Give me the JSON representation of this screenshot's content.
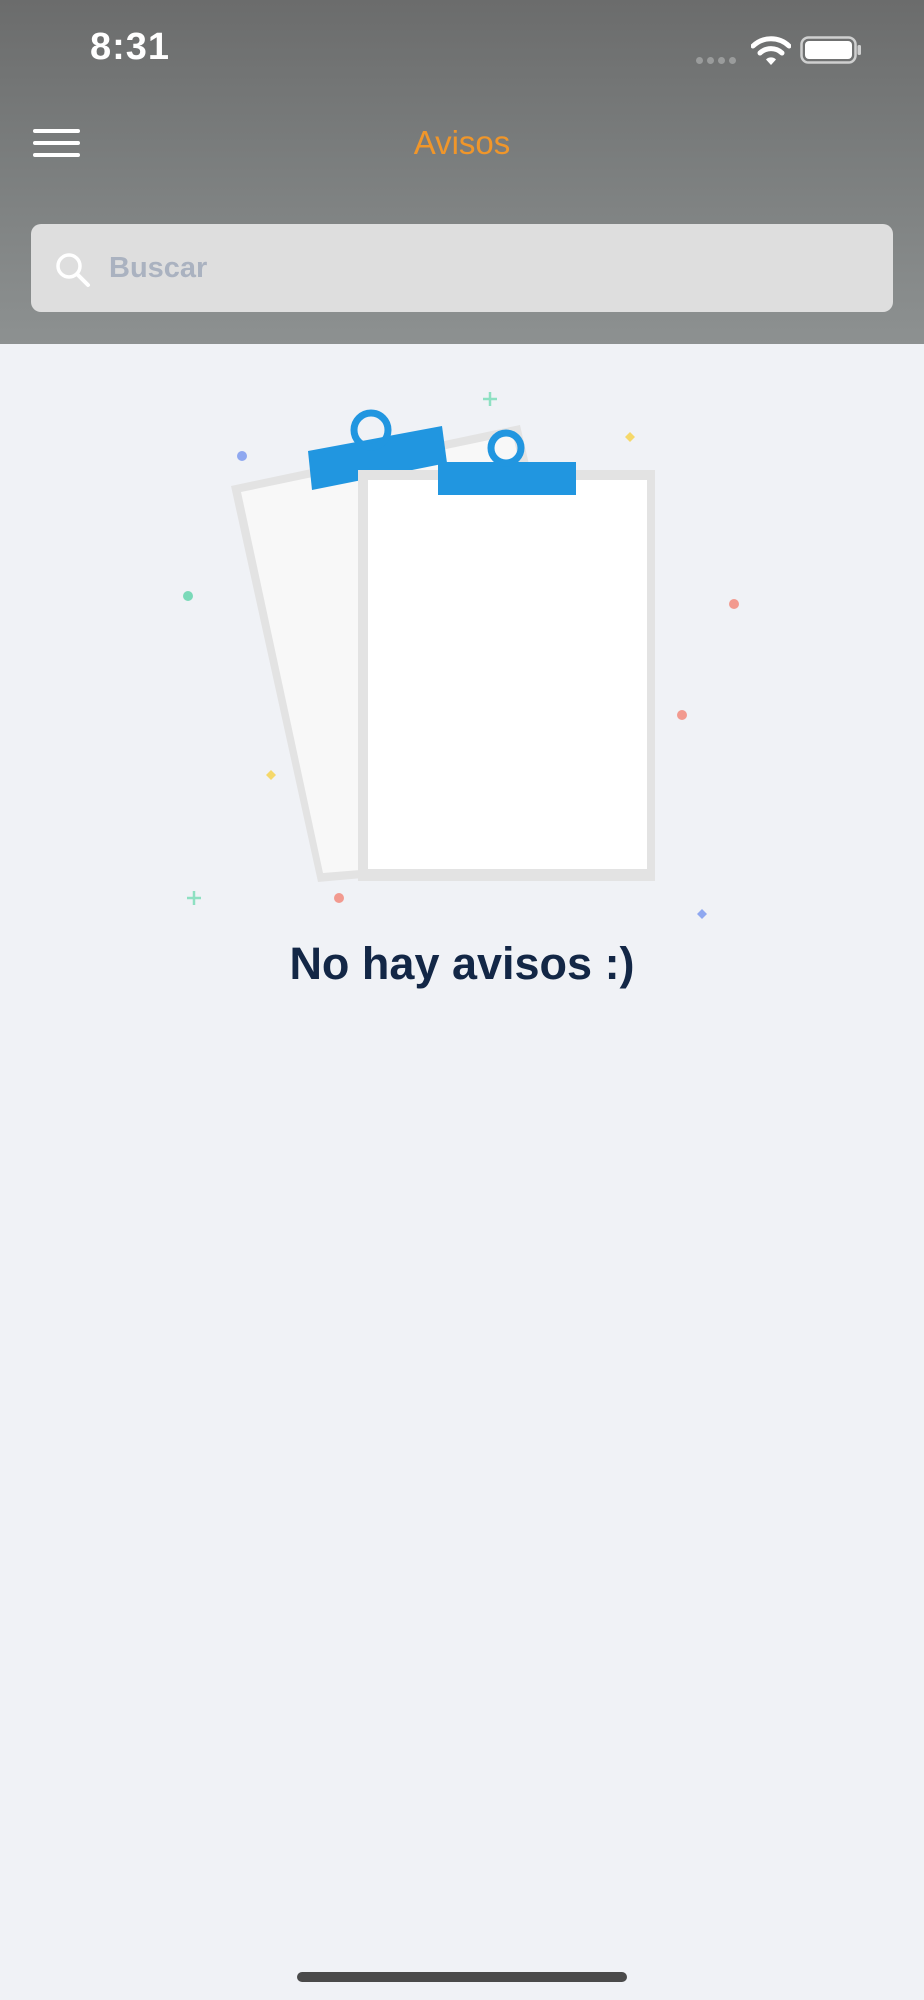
{
  "status_bar": {
    "time": "8:31",
    "icons": [
      "cellular-signal-icon",
      "wifi-icon",
      "battery-icon"
    ]
  },
  "header": {
    "title": "Avisos",
    "menu_icon": "hamburger-menu-icon"
  },
  "search": {
    "placeholder": "Buscar",
    "value": "",
    "icon": "search-icon"
  },
  "empty_state": {
    "illustration": "clipboards-illustration",
    "message": "No hay avisos :)"
  },
  "colors": {
    "header_top": "#6b6c6c",
    "header_bottom": "#8d9191",
    "title": "#f0962a",
    "background": "#f0f2f6",
    "clip_blue": "#2196e0",
    "message_text": "#132746"
  }
}
